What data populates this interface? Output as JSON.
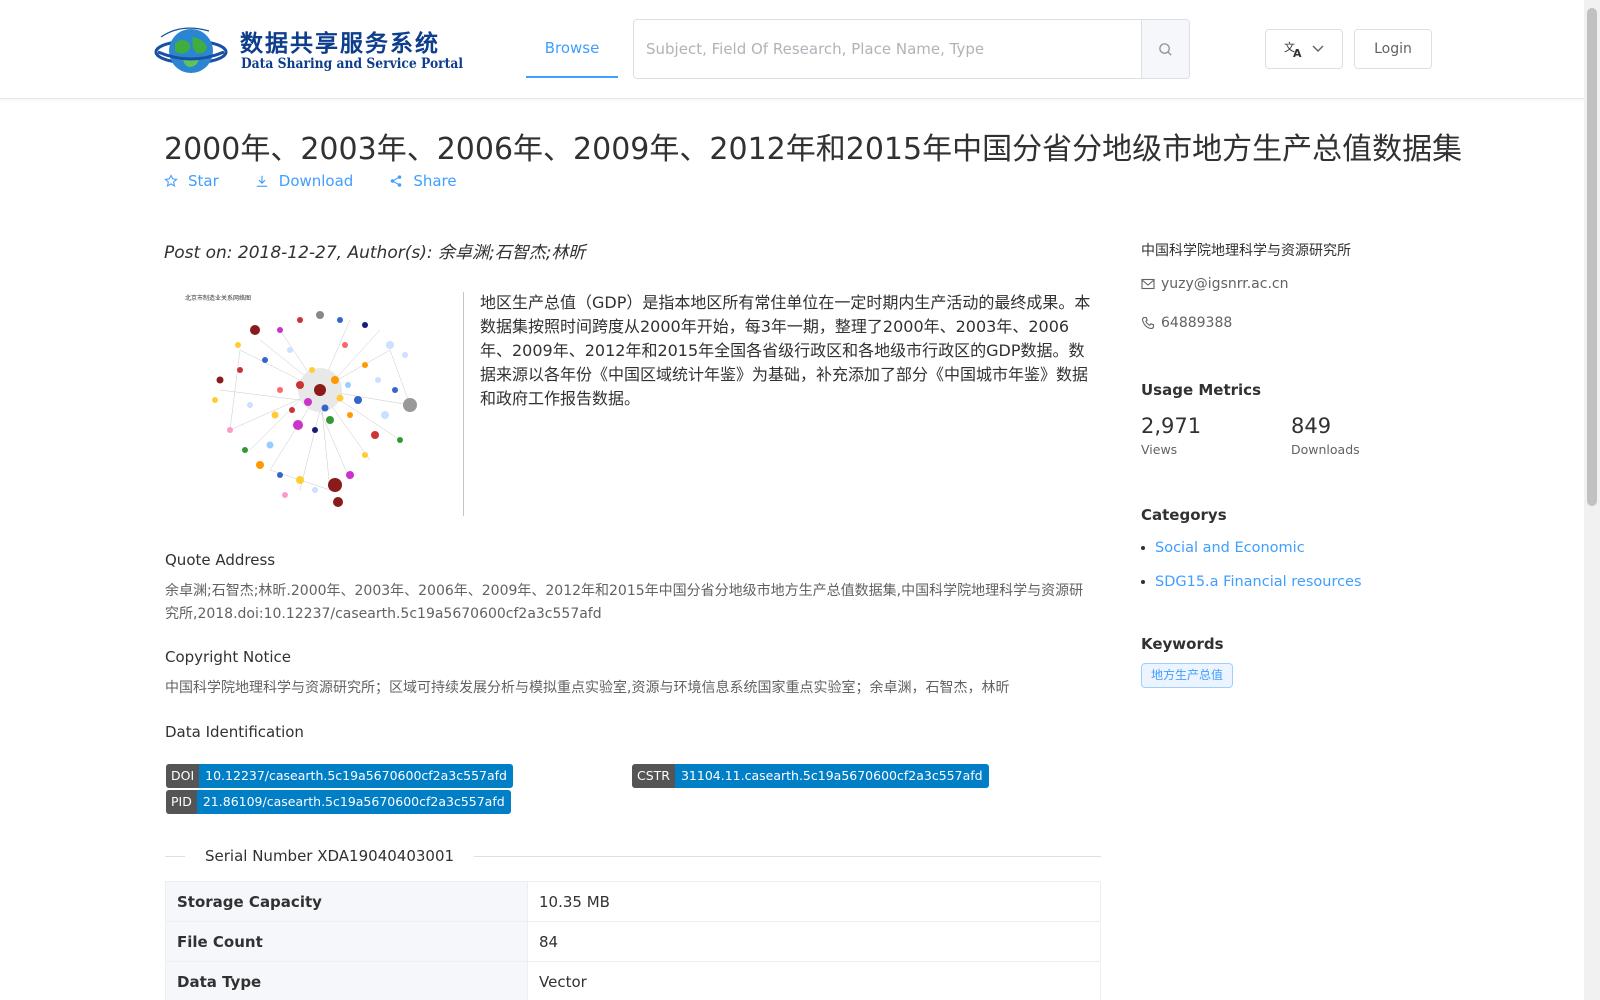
{
  "header": {
    "logo_cn": "数据共享服务系统",
    "logo_en": "Data Sharing and Service Portal",
    "nav_browse": "Browse",
    "search_placeholder": "Subject, Field Of Research, Place Name, Type",
    "login_label": "Login"
  },
  "title": "2000年、2003年、2006年、2009年、2012年和2015年中国分省分地级市地方生产总值数据集",
  "actions": {
    "star": "Star",
    "download": "Download",
    "share": "Share"
  },
  "post_on": "Post on: 2018-12-27, Author(s): 余卓渊;石智杰;林昕",
  "abstract": "地区生产总值（GDP）是指本地区所有常住单位在一定时期内生产活动的最终成果。本数据集按照时间跨度从2000年开始，每3年一期，整理了2000年、2003年、2006年、2009年、2012年和2015年全国各省级行政区和各地级市行政区的GDP数据。数据来源以各年份《中国区域统计年鉴》为基础，补充添加了部分《中国城市年鉴》数据和政府工作报告数据。",
  "quote": {
    "label": "Quote Address",
    "text": "余卓渊;石智杰;林昕.2000年、2003年、2006年、2009年、2012年和2015年中国分省分地级市地方生产总值数据集,中国科学院地理科学与资源研究所,2018.doi:10.12237/casearth.5c19a5670600cf2a3c557afd"
  },
  "copyright": {
    "label": "Copyright Notice",
    "text": "中国科学院地理科学与资源研究所；区域可持续发展分析与模拟重点实验室,资源与环境信息系统国家重点实验室；余卓渊，石智杰，林昕"
  },
  "identification": {
    "label": "Data Identification",
    "doi_key": "DOI",
    "doi_val": "10.12237/casearth.5c19a5670600cf2a3c557afd",
    "cstr_key": "CSTR",
    "cstr_val": "31104.11.casearth.5c19a5670600cf2a3c557afd",
    "pid_key": "PID",
    "pid_val": "21.86109/casearth.5c19a5670600cf2a3c557afd"
  },
  "serial": "Serial Number XDA19040403001",
  "table": [
    {
      "key": "Storage Capacity",
      "value": "10.35 MB"
    },
    {
      "key": "File Count",
      "value": "84"
    },
    {
      "key": "Data Type",
      "value": "Vector"
    }
  ],
  "sidebar": {
    "org": "中国科学院地理科学与资源研究所",
    "email": "yuzy@igsnrr.ac.cn",
    "phone": "64889388",
    "usage_heading": "Usage Metrics",
    "views_num": "2,971",
    "views_lbl": "Views",
    "downloads_num": "849",
    "downloads_lbl": "Downloads",
    "categories_heading": "Categorys",
    "categories": [
      "Social and Economic",
      "SDG15.a Financial resources"
    ],
    "keywords_heading": "Keywords",
    "keywords": [
      "地方生产总值"
    ]
  },
  "colors": {
    "accent": "#409eff",
    "badge_key": "#555555",
    "badge_val": "#007ec6"
  }
}
